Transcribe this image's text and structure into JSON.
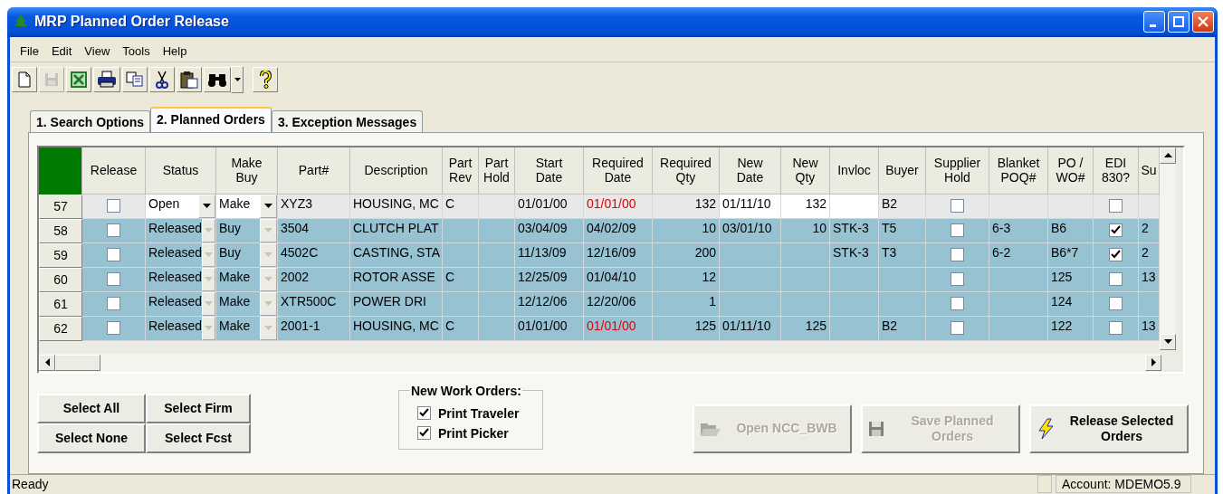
{
  "window": {
    "title": "MRP Planned Order Release"
  },
  "menu": [
    "File",
    "Edit",
    "View",
    "Tools",
    "Help"
  ],
  "toolbar": [
    {
      "kind": "new",
      "disabled": false
    },
    {
      "kind": "save",
      "disabled": true
    },
    {
      "kind": "excel",
      "disabled": false
    },
    {
      "kind": "print",
      "disabled": false
    },
    {
      "kind": "copy",
      "disabled": false
    },
    {
      "kind": "cut",
      "disabled": false
    },
    {
      "kind": "paste",
      "disabled": false
    },
    {
      "kind": "find",
      "disabled": false
    },
    {
      "kind": "help",
      "disabled": false
    }
  ],
  "tabs": [
    {
      "label": "1. Search Options",
      "selected": false
    },
    {
      "label": "2. Planned Orders",
      "selected": true
    },
    {
      "label": "3. Exception Messages",
      "selected": false
    }
  ],
  "grid": {
    "columns": [
      {
        "label": "Release",
        "kind": "check"
      },
      {
        "label": "Status",
        "kind": "combo"
      },
      {
        "label": "Make\nBuy",
        "kind": "combo"
      },
      {
        "label": "Part#",
        "kind": "text"
      },
      {
        "label": "Description",
        "kind": "text"
      },
      {
        "label": "Part\nRev",
        "kind": "text"
      },
      {
        "label": "Part\nHold",
        "kind": "text"
      },
      {
        "label": "Start\nDate",
        "kind": "text"
      },
      {
        "label": "Required\nDate",
        "kind": "text"
      },
      {
        "label": "Required\nQty",
        "kind": "num"
      },
      {
        "label": "New\nDate",
        "kind": "text"
      },
      {
        "label": "New\nQty",
        "kind": "num"
      },
      {
        "label": "Invloc",
        "kind": "text"
      },
      {
        "label": "Buyer",
        "kind": "text"
      },
      {
        "label": "Supplier\nHold",
        "kind": "check"
      },
      {
        "label": "Blanket\nPOQ#",
        "kind": "text"
      },
      {
        "label": "PO /\nWO#",
        "kind": "text"
      },
      {
        "label": "EDI\n830?",
        "kind": "check"
      },
      {
        "label": "Su",
        "kind": "text"
      }
    ],
    "rows": [
      {
        "number": "57",
        "current": true,
        "cells": [
          {
            "checked": false
          },
          {
            "text": "Open"
          },
          {
            "text": "Make"
          },
          {
            "text": "XYZ3"
          },
          {
            "text": "HOUSING, MC"
          },
          {
            "text": "C"
          },
          {},
          {
            "text": "01/01/00"
          },
          {
            "text": "01/01/00",
            "late": true
          },
          {
            "text": "132"
          },
          {
            "text": "01/11/10"
          },
          {
            "text": "132"
          },
          {},
          {
            "text": "B2"
          },
          {
            "checked": false
          },
          {},
          {},
          {
            "checked": false
          },
          {}
        ]
      },
      {
        "number": "58",
        "current": false,
        "cells": [
          {
            "checked": false
          },
          {
            "text": "Released"
          },
          {
            "text": "Buy"
          },
          {
            "text": "3504"
          },
          {
            "text": "CLUTCH PLAT"
          },
          {},
          {},
          {
            "text": "03/04/09"
          },
          {
            "text": "04/02/09",
            "late": false
          },
          {
            "text": "10"
          },
          {
            "text": "03/01/10"
          },
          {
            "text": "10"
          },
          {
            "text": "STK-3"
          },
          {
            "text": "T5"
          },
          {
            "checked": false
          },
          {
            "text": "6-3"
          },
          {
            "text": "B6"
          },
          {
            "checked": true
          },
          {
            "text": "2"
          }
        ]
      },
      {
        "number": "59",
        "current": false,
        "cells": [
          {
            "checked": false
          },
          {
            "text": "Released"
          },
          {
            "text": "Buy"
          },
          {
            "text": "4502C"
          },
          {
            "text": "CASTING, STA"
          },
          {},
          {},
          {
            "text": "11/13/09"
          },
          {
            "text": "12/16/09",
            "late": false
          },
          {
            "text": "200"
          },
          {},
          {},
          {
            "text": "STK-3"
          },
          {
            "text": "T3"
          },
          {
            "checked": false
          },
          {
            "text": "6-2"
          },
          {
            "text": "B6*7"
          },
          {
            "checked": true
          },
          {
            "text": "2"
          }
        ]
      },
      {
        "number": "60",
        "current": false,
        "cells": [
          {
            "checked": false
          },
          {
            "text": "Released"
          },
          {
            "text": "Make"
          },
          {
            "text": "2002"
          },
          {
            "text": "ROTOR ASSE"
          },
          {
            "text": "C"
          },
          {},
          {
            "text": "12/25/09"
          },
          {
            "text": "01/04/10",
            "late": false
          },
          {
            "text": "12"
          },
          {},
          {},
          {},
          {},
          {
            "checked": false
          },
          {},
          {
            "text": "125"
          },
          {
            "checked": false
          },
          {
            "text": "13"
          }
        ]
      },
      {
        "number": "61",
        "current": false,
        "cells": [
          {
            "checked": false
          },
          {
            "text": "Released"
          },
          {
            "text": "Make"
          },
          {
            "text": "XTR500C"
          },
          {
            "text": "POWER DRI"
          },
          {},
          {},
          {
            "text": "12/12/06"
          },
          {
            "text": "12/20/06",
            "late": false
          },
          {
            "text": "1"
          },
          {},
          {},
          {},
          {},
          {
            "checked": false
          },
          {},
          {
            "text": "124"
          },
          {
            "checked": false
          },
          {}
        ]
      },
      {
        "number": "62",
        "current": false,
        "cells": [
          {
            "checked": false
          },
          {
            "text": "Released"
          },
          {
            "text": "Make"
          },
          {
            "text": "2001-1"
          },
          {
            "text": "HOUSING, MC"
          },
          {
            "text": "C"
          },
          {},
          {
            "text": "01/01/00"
          },
          {
            "text": "01/01/00",
            "late": true
          },
          {
            "text": "125"
          },
          {
            "text": "01/11/10"
          },
          {
            "text": "125"
          },
          {},
          {
            "text": "B2"
          },
          {
            "checked": false
          },
          {},
          {
            "text": "122"
          },
          {
            "checked": false
          },
          {
            "text": "13"
          }
        ]
      }
    ]
  },
  "select_buttons": [
    "Select All",
    "Select Firm",
    "Select None",
    "Select Fcst"
  ],
  "new_work_orders": {
    "title": "New Work Orders:",
    "options": [
      {
        "label": "Print Traveler",
        "checked": true
      },
      {
        "label": "Print Picker",
        "checked": true
      }
    ]
  },
  "action_buttons": [
    {
      "label": "Open NCC_BWB",
      "kind": "open",
      "disabled": true
    },
    {
      "label": "Save Planned\nOrders",
      "kind": "save",
      "disabled": true
    },
    {
      "label": "Release Selected\nOrders",
      "kind": "release",
      "disabled": false
    }
  ],
  "status_bar": {
    "text": "Ready",
    "account": "Account: MDEMO5.9"
  }
}
